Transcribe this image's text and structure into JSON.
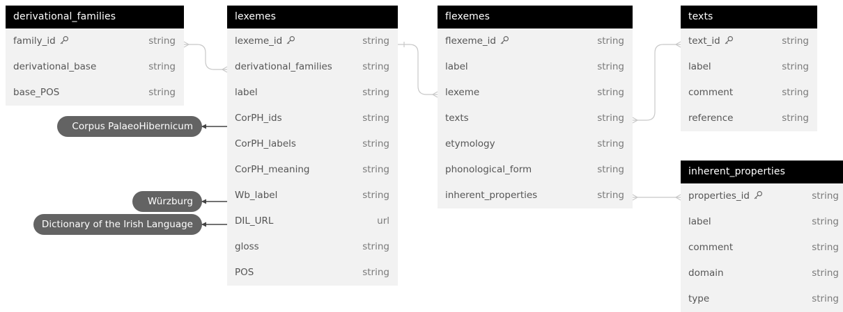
{
  "tables": {
    "derivational_families": {
      "title": "derivational_families",
      "fields": [
        {
          "name": "family_id",
          "type": "string",
          "key": true
        },
        {
          "name": "derivational_base",
          "type": "string"
        },
        {
          "name": "base_POS",
          "type": "string"
        }
      ]
    },
    "lexemes": {
      "title": "lexemes",
      "fields": [
        {
          "name": "lexeme_id",
          "type": "string",
          "key": true
        },
        {
          "name": "derivational_families",
          "type": "string"
        },
        {
          "name": "label",
          "type": "string"
        },
        {
          "name": "CorPH_ids",
          "type": "string"
        },
        {
          "name": "CorPH_labels",
          "type": "string"
        },
        {
          "name": "CorPH_meaning",
          "type": "string"
        },
        {
          "name": "Wb_label",
          "type": "string"
        },
        {
          "name": "DIL_URL",
          "type": "url"
        },
        {
          "name": "gloss",
          "type": "string"
        },
        {
          "name": "POS",
          "type": "string"
        }
      ]
    },
    "flexemes": {
      "title": "flexemes",
      "fields": [
        {
          "name": "flexeme_id",
          "type": "string",
          "key": true
        },
        {
          "name": "label",
          "type": "string"
        },
        {
          "name": "lexeme",
          "type": "string"
        },
        {
          "name": "texts",
          "type": "string"
        },
        {
          "name": "etymology",
          "type": "string"
        },
        {
          "name": "phonological_form",
          "type": "string"
        },
        {
          "name": "inherent_properties",
          "type": "string"
        }
      ]
    },
    "texts": {
      "title": "texts",
      "fields": [
        {
          "name": "text_id",
          "type": "string",
          "key": true
        },
        {
          "name": "label",
          "type": "string"
        },
        {
          "name": "comment",
          "type": "string"
        },
        {
          "name": "reference",
          "type": "string"
        }
      ]
    },
    "inherent_properties": {
      "title": "inherent_properties",
      "fields": [
        {
          "name": "properties_id",
          "type": "string",
          "key": true
        },
        {
          "name": "label",
          "type": "string"
        },
        {
          "name": "comment",
          "type": "string"
        },
        {
          "name": "domain",
          "type": "string"
        },
        {
          "name": "type",
          "type": "string"
        }
      ]
    }
  },
  "external_sources": [
    {
      "label": "Corpus PalaeoHibernicum",
      "target_field": "CorPH_ids"
    },
    {
      "label": "Würzburg",
      "target_field": "Wb_label"
    },
    {
      "label": "Dictionary of the Irish Language",
      "target_field": "DIL_URL"
    }
  ],
  "relations": [
    {
      "from": "lexemes.derivational_families",
      "to": "derivational_families.family_id"
    },
    {
      "from": "flexemes.lexeme",
      "to": "lexemes.lexeme_id"
    },
    {
      "from": "flexemes.texts",
      "to": "texts.text_id"
    },
    {
      "from": "flexemes.inherent_properties",
      "to": "inherent_properties.properties_id"
    }
  ],
  "colors": {
    "header_bg": "#000000",
    "header_text": "#ffffff",
    "table_bg": "#f2f2f2",
    "pill_bg": "#636363",
    "connector": "#c8c8c8",
    "arrow": "#444444"
  },
  "icons": {
    "key": "key-icon",
    "arrow": "arrow-left-icon"
  }
}
